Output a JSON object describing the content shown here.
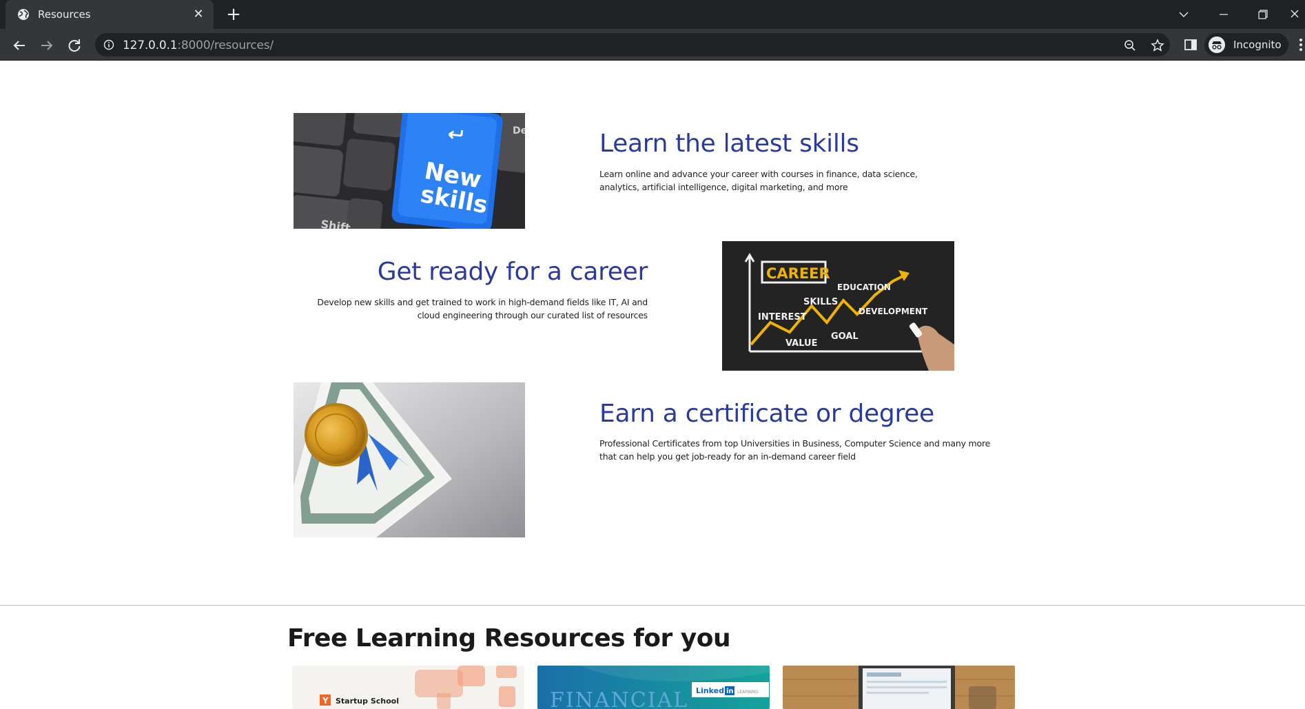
{
  "browser": {
    "tab_title": "Resources",
    "tab_close": "✕",
    "new_tab": "+",
    "url_host": "127.0.0.1",
    "url_path": ":8000/resources/",
    "profile_label": "Incognito"
  },
  "features": [
    {
      "title": "Learn the latest skills",
      "description": "Learn online and advance your career with courses in finance, data science, analytics, artificial intelligence, digital marketing, and more",
      "image": {
        "key_text_1": "New",
        "key_text_2": "skills",
        "key_shift": "Shift",
        "key_del": "De"
      }
    },
    {
      "title": "Get ready for a career",
      "description": "Develop new skills and get trained to work in high-demand fields like IT, AI and cloud engineering through our curated list of resources",
      "image": {
        "career": "CAREER",
        "education": "EDUCATION",
        "skills": "SKILLS",
        "interest": "INTEREST",
        "development": "DEVELOPMENT",
        "goal": "GOAL",
        "value": "VALUE"
      }
    },
    {
      "title": "Earn a certificate or degree",
      "description": "Professional Certificates from top Universities in Business, Computer Science and many more that can help you get job-ready for an in-demand career field",
      "image": {}
    }
  ],
  "resources_section": {
    "title": "Free Learning Resources for you",
    "cards": [
      {
        "label": "Startup School",
        "badge": "Y"
      },
      {
        "label": "FINANCIAL",
        "badge_left": "Linked",
        "badge_in": "in",
        "badge_right": "LEARNING"
      },
      {
        "label": ""
      }
    ]
  },
  "colors": {
    "heading_blue": "#2b3a9e",
    "chrome_dark": "#202124",
    "chrome_toolbar": "#35363a",
    "key_blue": "#1f6fe8",
    "career_arrow": "#f0b400"
  }
}
